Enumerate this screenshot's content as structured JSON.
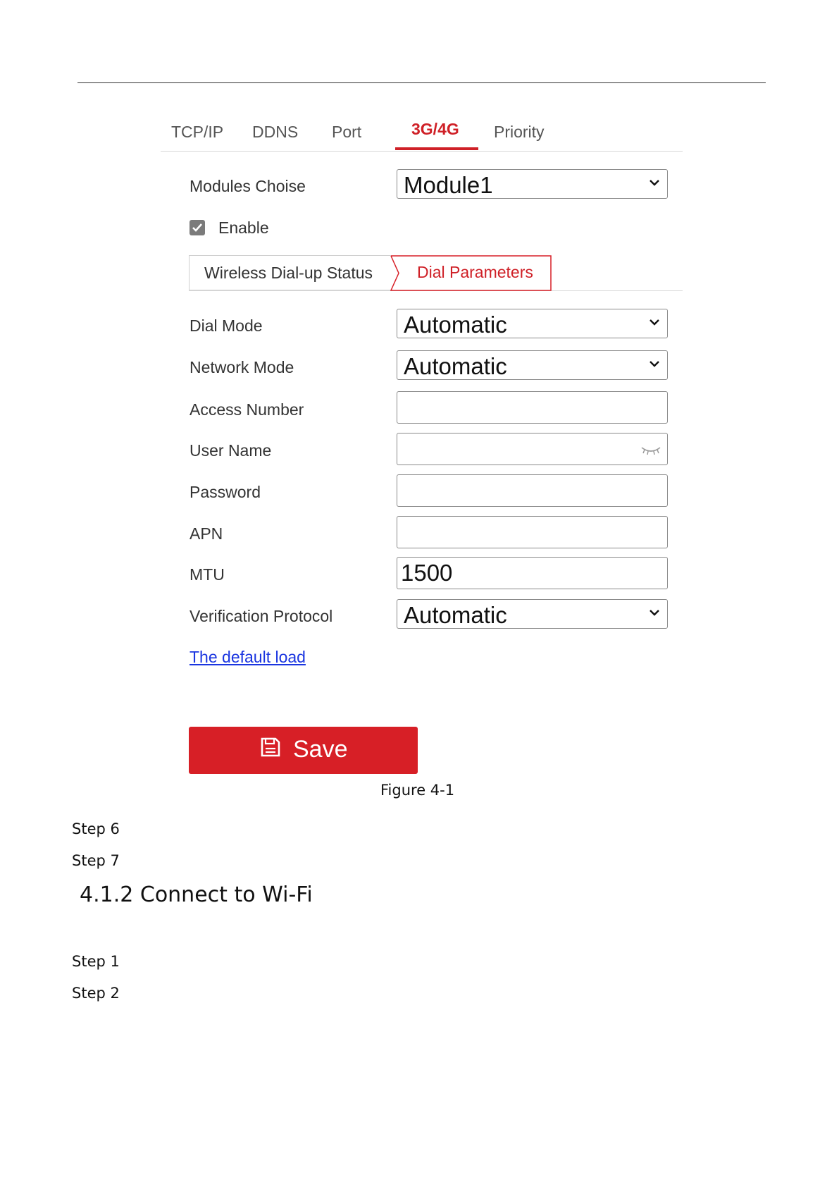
{
  "tabs": [
    {
      "label": "TCP/IP",
      "active": false
    },
    {
      "label": "DDNS",
      "active": false
    },
    {
      "label": "Port",
      "active": false
    },
    {
      "label": "3G/4G",
      "active": true
    },
    {
      "label": "Priority",
      "active": false
    }
  ],
  "modules": {
    "label": "Modules Choise",
    "value": "Module1"
  },
  "enable": {
    "label": "Enable",
    "checked": true
  },
  "subtabs": {
    "status": "Wireless Dial-up Status",
    "dial": "Dial Parameters"
  },
  "fields": {
    "dial_mode": {
      "label": "Dial Mode",
      "value": "Automatic"
    },
    "network_mode": {
      "label": "Network Mode",
      "value": "Automatic"
    },
    "access_number": {
      "label": "Access Number",
      "value": ""
    },
    "user_name": {
      "label": "User Name",
      "value": ""
    },
    "password": {
      "label": "Password",
      "value": ""
    },
    "apn": {
      "label": "APN",
      "value": ""
    },
    "mtu": {
      "label": "MTU",
      "value": "1500"
    },
    "verification_protocol": {
      "label": "Verification Protocol",
      "value": "Automatic"
    }
  },
  "default_load_link": "The default load",
  "save_button": "Save",
  "caption": "Figure 4-1",
  "steps_before": [
    "Step 6",
    "Step 7"
  ],
  "section_heading": "4.1.2 Connect to Wi-Fi",
  "steps_after": [
    "Step 1",
    "Step 2"
  ],
  "colors": {
    "accent": "#d71f26",
    "link": "#1a35e0"
  }
}
